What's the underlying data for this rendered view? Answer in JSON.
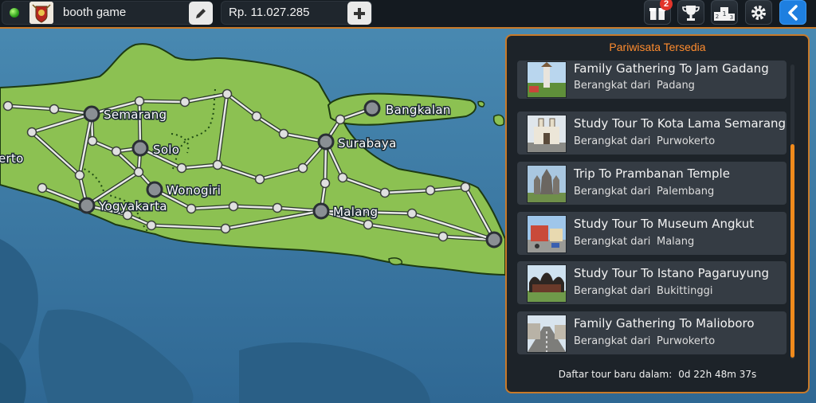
{
  "topbar": {
    "player_name": "booth game",
    "money": "Rp. 11.027.285",
    "gift_badge": "2",
    "icons": [
      "status-online-icon",
      "avatar-icon",
      "edit-pencil-icon",
      "plus-icon",
      "gift-icon",
      "trophy-icon",
      "podium-icon",
      "gear-icon",
      "back-arrow-icon"
    ],
    "colors": {
      "accent": "#c87a2a",
      "back_button": "#1e7fe0",
      "badge": "#e2352b"
    }
  },
  "map": {
    "cities": [
      "Semarang",
      "Solo",
      "Wonogiri",
      "Yogyakarta",
      "Bangkalan",
      "Surabaya",
      "Malang",
      "erto"
    ],
    "colors": {
      "sea": "#3f7ea8",
      "land": "#8cc152",
      "route": "#e9e9e9"
    }
  },
  "panel": {
    "title": "Pariwisata Tersedia",
    "departure_label": "Berangkat dari",
    "tours": [
      {
        "title": "Family Gathering To Jam Gadang",
        "from": "Padang"
      },
      {
        "title": "Study Tour To Kota Lama Semarang",
        "from": "Purwokerto"
      },
      {
        "title": "Trip To Prambanan Temple",
        "from": "Palembang"
      },
      {
        "title": "Study Tour To Museum Angkut",
        "from": "Malang"
      },
      {
        "title": "Study Tour To Istano Pagaruyung",
        "from": "Bukittinggi"
      },
      {
        "title": "Family Gathering To Malioboro",
        "from": "Purwokerto"
      }
    ],
    "footer_label": "Daftar tour baru dalam:",
    "footer_timer": "0d 22h 48m 37s",
    "colors": {
      "title": "#ff8c2e",
      "scroll": "#f08a1c"
    }
  }
}
